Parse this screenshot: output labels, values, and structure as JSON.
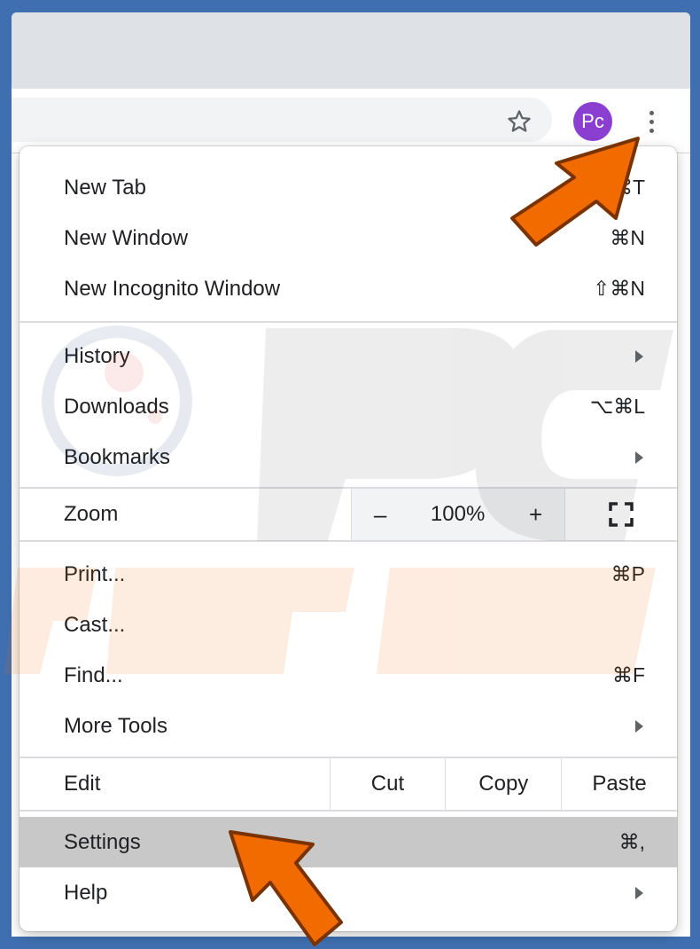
{
  "toolbar": {
    "profile_initials": "Pc",
    "icons": {
      "bookmark": "star-icon",
      "menu": "three-dots-icon"
    }
  },
  "menu": {
    "section1": [
      {
        "label": "New Tab",
        "shortcut": "⌘T"
      },
      {
        "label": "New Window",
        "shortcut": "⌘N"
      },
      {
        "label": "New Incognito Window",
        "shortcut": "⇧⌘N"
      }
    ],
    "section2": [
      {
        "label": "History",
        "submenu": true
      },
      {
        "label": "Downloads",
        "shortcut": "⌥⌘L"
      },
      {
        "label": "Bookmarks",
        "submenu": true
      }
    ],
    "zoom": {
      "label": "Zoom",
      "minus": "–",
      "level": "100%",
      "plus": "+",
      "fullscreen_icon": "fullscreen-icon"
    },
    "section3": [
      {
        "label": "Print...",
        "shortcut": "⌘P"
      },
      {
        "label": "Cast..."
      },
      {
        "label": "Find...",
        "shortcut": "⌘F"
      },
      {
        "label": "More Tools",
        "submenu": true
      }
    ],
    "edit": {
      "label": "Edit",
      "cut": "Cut",
      "copy": "Copy",
      "paste": "Paste"
    },
    "section4": [
      {
        "label": "Settings",
        "shortcut": "⌘,",
        "highlighted": true
      },
      {
        "label": "Help",
        "submenu": true
      }
    ]
  },
  "colors": {
    "background": "#3f6fb0",
    "avatar": "#8b3fd1",
    "highlight": "#c8c8c8",
    "callout_arrow": "#f26b00"
  }
}
